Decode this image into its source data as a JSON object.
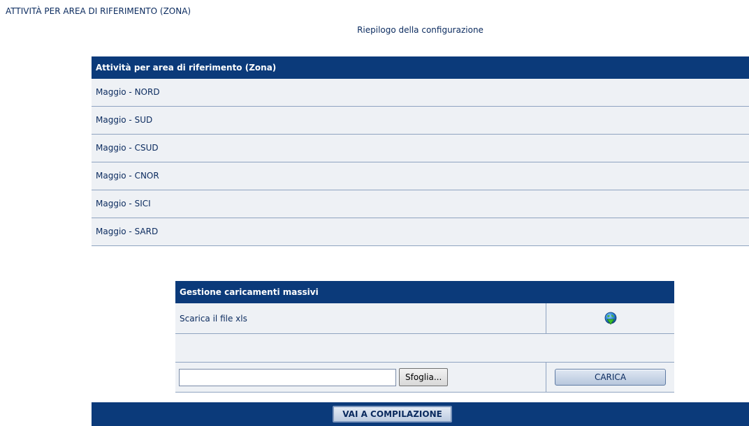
{
  "page": {
    "title": "ATTIVITÀ PER AREA DI RIFERIMENTO (ZONA)",
    "subtitle": "Riepilogo della configurazione"
  },
  "zones": {
    "header": "Attività per area di riferimento (Zona)",
    "items": [
      {
        "label": "Maggio - NORD"
      },
      {
        "label": "Maggio - SUD"
      },
      {
        "label": "Maggio - CSUD"
      },
      {
        "label": "Maggio - CNOR"
      },
      {
        "label": "Maggio - SICI"
      },
      {
        "label": "Maggio - SARD"
      }
    ]
  },
  "bulk": {
    "header": "Gestione caricamenti massivi",
    "download_label": "Scarica il file xls",
    "download_icon": "download-globe-icon",
    "file_input_value": "",
    "browse_label": "Sfoglia...",
    "load_label": "CARICA"
  },
  "footer": {
    "compile_label": "VAI A COMPILAZIONE"
  },
  "colors": {
    "header_bg": "#0b3a7a",
    "row_bg": "#eef1f5",
    "text": "#0a2a5e"
  }
}
